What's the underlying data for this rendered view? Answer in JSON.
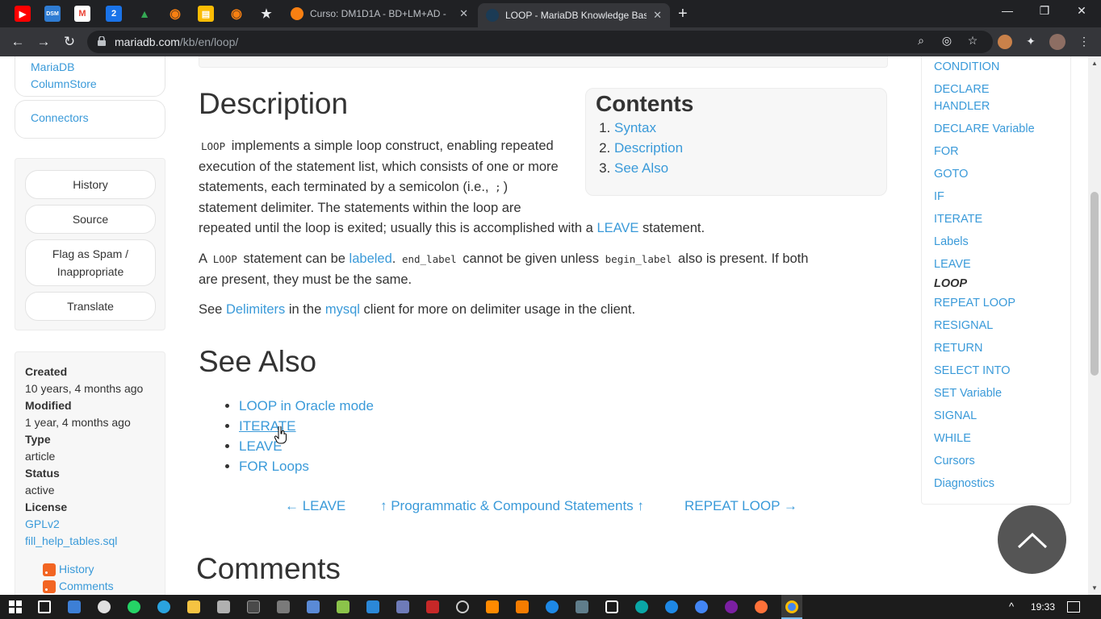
{
  "browser": {
    "pinned_tabs": [
      {
        "name": "youtube-icon",
        "color": "#ff0000",
        "glyph": "▶"
      },
      {
        "name": "dsm-icon",
        "color": "#2f7cd3",
        "glyph": "DSM"
      },
      {
        "name": "gmail-icon",
        "color": "#ea4335",
        "glyph": "M"
      },
      {
        "name": "calendar-icon",
        "color": "#1a73e8",
        "glyph": "2"
      },
      {
        "name": "drive-icon",
        "color": "#34a853",
        "glyph": "▲"
      },
      {
        "name": "moodle-icon",
        "color": "#f98012",
        "glyph": "◉"
      },
      {
        "name": "keep-icon",
        "color": "#fbbc04",
        "glyph": "▤"
      },
      {
        "name": "moodle2-icon",
        "color": "#f98012",
        "glyph": "◉"
      },
      {
        "name": "bookmark-icon",
        "color": "#202124",
        "glyph": "★"
      }
    ],
    "tabs": [
      {
        "title": "Curso: DM1D1A - BD+LM+AD - "
      },
      {
        "title": "LOOP - MariaDB Knowledge Base"
      }
    ],
    "url_domain": "mariadb.com",
    "url_path": "/kb/en/loop/"
  },
  "left_sidebar": {
    "products": [
      "MariaDB",
      "ColumnStore"
    ],
    "connectors": "Connectors",
    "actions": [
      "History",
      "Source",
      "Flag as Spam /",
      "Inappropriate",
      "Translate"
    ],
    "info": {
      "created_label": "Created",
      "created_value": "10 years, 4 months ago",
      "modified_label": "Modified",
      "modified_value": "1 year, 4 months ago",
      "type_label": "Type",
      "type_value": "article",
      "status_label": "Status",
      "status_value": "active",
      "license_label": "License",
      "license_value": "GPLv2",
      "license_file": "fill_help_tables.sql",
      "feed_history": "History",
      "feed_comments": "Comments"
    }
  },
  "main": {
    "description_heading": "Description",
    "toc": {
      "title": "Contents",
      "items": [
        "Syntax",
        "Description",
        "See Also"
      ]
    },
    "p1": {
      "code1": "LOOP",
      "t1": " implements a simple loop construct, enabling repeated",
      "t2": "execution of the statement list, which consists of one or more",
      "t3": "statements, each terminated by a semicolon (i.e.,",
      "code2": ";",
      "t4": ")",
      "t5": "statement delimiter. The statements within the loop are",
      "t6": "repeated until the loop is exited; usually this is accomplished with a",
      "link": "LEAVE",
      "t7": " statement."
    },
    "p2": {
      "t1": "A ",
      "code1": "LOOP",
      "t2": " statement can be ",
      "link": "labeled",
      "t3": ". ",
      "code2": "end_label",
      "t4": " cannot be given unless ",
      "code3": "begin_label",
      "t5": " also is present. If both",
      "t6": "are present, they must be the same."
    },
    "p3": {
      "t1": "See ",
      "link1": "Delimiters",
      "t2": " in the ",
      "link2": "mysql",
      "t3": " client for more on delimiter usage in the client."
    },
    "see_also_heading": "See Also",
    "see_also": [
      "LOOP in Oracle mode",
      "ITERATE",
      "LEAVE",
      "FOR Loops"
    ],
    "nav": {
      "prev": "← LEAVE",
      "up": "↑ Programmatic & Compound Statements ↑",
      "next": "REPEAT LOOP →"
    },
    "comments_heading": "Comments"
  },
  "right_sidebar": {
    "items": [
      "CONDITION",
      "DECLARE HANDLER",
      "DECLARE Variable",
      "FOR",
      "GOTO",
      "IF",
      "ITERATE",
      "Labels",
      "LEAVE",
      "LOOP",
      "REPEAT LOOP",
      "RESIGNAL",
      "RETURN",
      "SELECT INTO",
      "SET Variable",
      "SIGNAL",
      "WHILE",
      "Cursors",
      "Diagnostics"
    ],
    "current": "LOOP"
  },
  "taskbar": {
    "clock": "19:33"
  },
  "colors": {
    "link": "#3a9ad9",
    "text": "#333333",
    "tabstrip": "#202124",
    "toolbar": "#35363a"
  }
}
